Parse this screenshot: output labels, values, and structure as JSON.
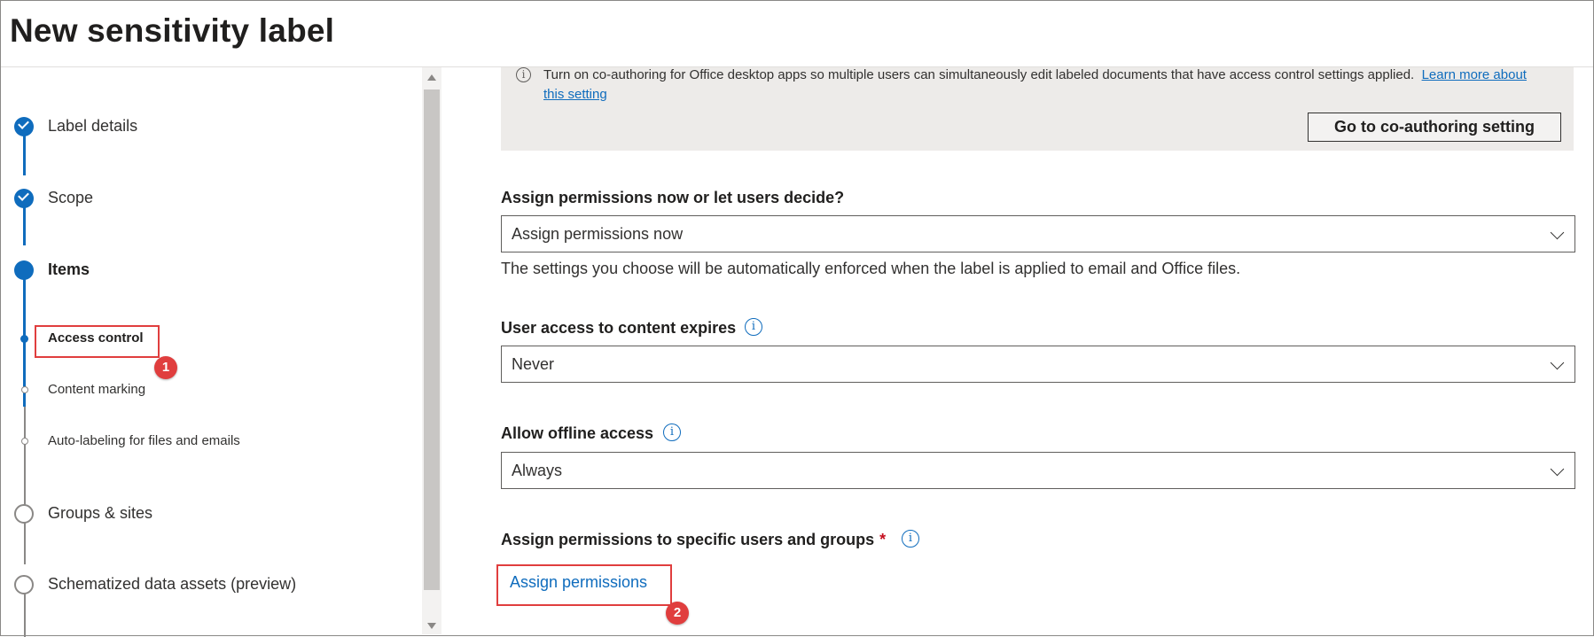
{
  "page": {
    "title": "New sensitivity label"
  },
  "nav": {
    "steps": [
      {
        "label": "Label details",
        "state": "complete"
      },
      {
        "label": "Scope",
        "state": "complete"
      },
      {
        "label": "Items",
        "state": "current"
      },
      {
        "label": "Access control",
        "state": "current-substep"
      },
      {
        "label": "Content marking",
        "state": "pending-substep"
      },
      {
        "label": "Auto-labeling for files and emails",
        "state": "pending-substep"
      },
      {
        "label": "Groups & sites",
        "state": "pending"
      },
      {
        "label": "Schematized data assets (preview)",
        "state": "pending"
      }
    ]
  },
  "callouts": [
    "1",
    "2"
  ],
  "info": {
    "text": "Turn on co-authoring for Office desktop apps so multiple users can simultaneously edit labeled documents that have access control settings applied.",
    "link": "Learn more about this setting",
    "button": "Go to co-authoring setting"
  },
  "assign_mode": {
    "label": "Assign permissions now or let users decide?",
    "value": "Assign permissions now",
    "helper": "The settings you choose will be automatically enforced when the label is applied to email and Office files."
  },
  "expires": {
    "label": "User access to content expires",
    "value": "Never"
  },
  "offline": {
    "label": "Allow offline access",
    "value": "Always"
  },
  "assign_users": {
    "label": "Assign permissions to specific users and groups",
    "required_mark": "*",
    "link": "Assign permissions"
  },
  "colors": {
    "accent": "#0f6cbd",
    "callout": "#e03e3e",
    "required": "#c50f1f"
  }
}
